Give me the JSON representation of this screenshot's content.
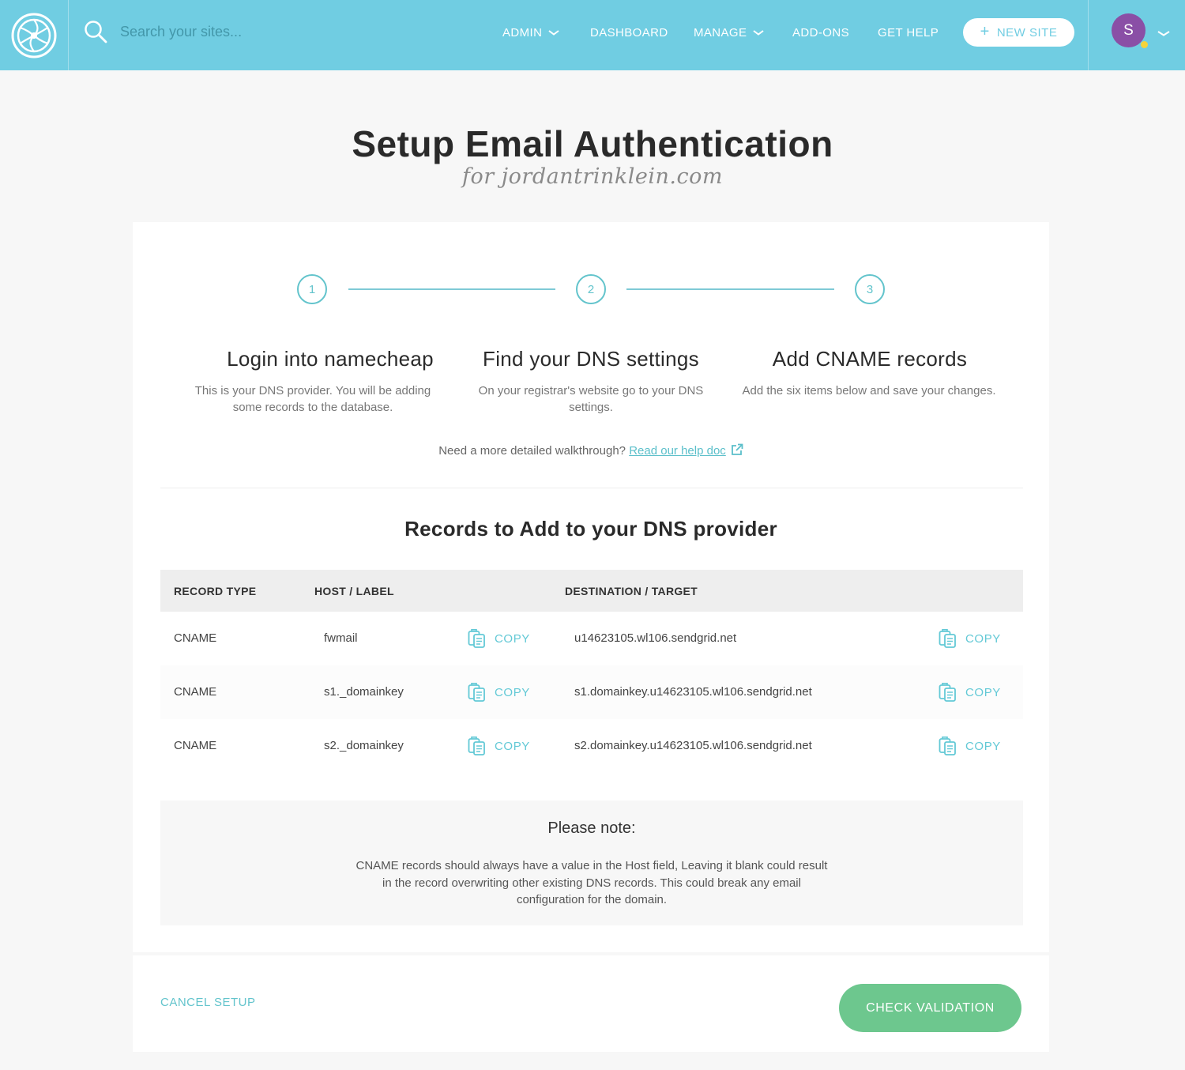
{
  "nav": {
    "search_placeholder": "Search your sites...",
    "items": [
      {
        "label": "ADMIN",
        "has_dropdown": true
      },
      {
        "label": "DASHBOARD",
        "has_dropdown": false
      },
      {
        "label": "MANAGE",
        "has_dropdown": true
      },
      {
        "label": "ADD-ONS",
        "has_dropdown": false
      },
      {
        "label": "GET HELP",
        "has_dropdown": false
      }
    ],
    "new_site_label": "NEW SITE",
    "user_initial": "S",
    "icons": {
      "logo": "flywheel-logo-icon",
      "search": "search-icon",
      "plus": "plus-icon",
      "user_menu": "chevron-down-icon"
    }
  },
  "page": {
    "title": "Setup Email Authentication",
    "subtitle": "for jordantrinklein.com"
  },
  "steps": [
    {
      "number": "1",
      "title": "Login into namecheap",
      "description": "This is your DNS provider. You will be adding some records to the database."
    },
    {
      "number": "2",
      "title": "Find your DNS settings",
      "description": "On your registrar's website go to your DNS settings."
    },
    {
      "number": "3",
      "title": "Add CNAME records",
      "description": "Add the six items below and save your changes."
    }
  ],
  "walkthrough": {
    "text": "Need a more detailed walkthrough?",
    "link_label": "Read our help doc"
  },
  "records": {
    "title": "Records to Add to your DNS provider",
    "columns": [
      "RECORD TYPE",
      "HOST / LABEL",
      "DESTINATION / TARGET"
    ],
    "copy_label": "COPY",
    "rows": [
      {
        "type": "CNAME",
        "host": "fwmail",
        "target": "u14623105.wl106.sendgrid.net"
      },
      {
        "type": "CNAME",
        "host": "s1._domainkey",
        "target": "s1.domainkey.u14623105.wl106.sendgrid.net"
      },
      {
        "type": "CNAME",
        "host": "s2._domainkey",
        "target": "s2.domainkey.u14623105.wl106.sendgrid.net"
      }
    ]
  },
  "note": {
    "title": "Please note:",
    "body": "CNAME records should always have a value in the Host field, Leaving it blank could result in the record overwriting other existing DNS records. This could break any email configuration for the domain."
  },
  "footer": {
    "cancel_label": "CANCEL SETUP",
    "check_label": "CHECK VALIDATION"
  },
  "colors": {
    "topbar": "#70cde2",
    "accent": "#63c4cc",
    "primary_button": "#6dc78e",
    "avatar": "#8a4fa6",
    "status_dot": "#f5d33b"
  }
}
